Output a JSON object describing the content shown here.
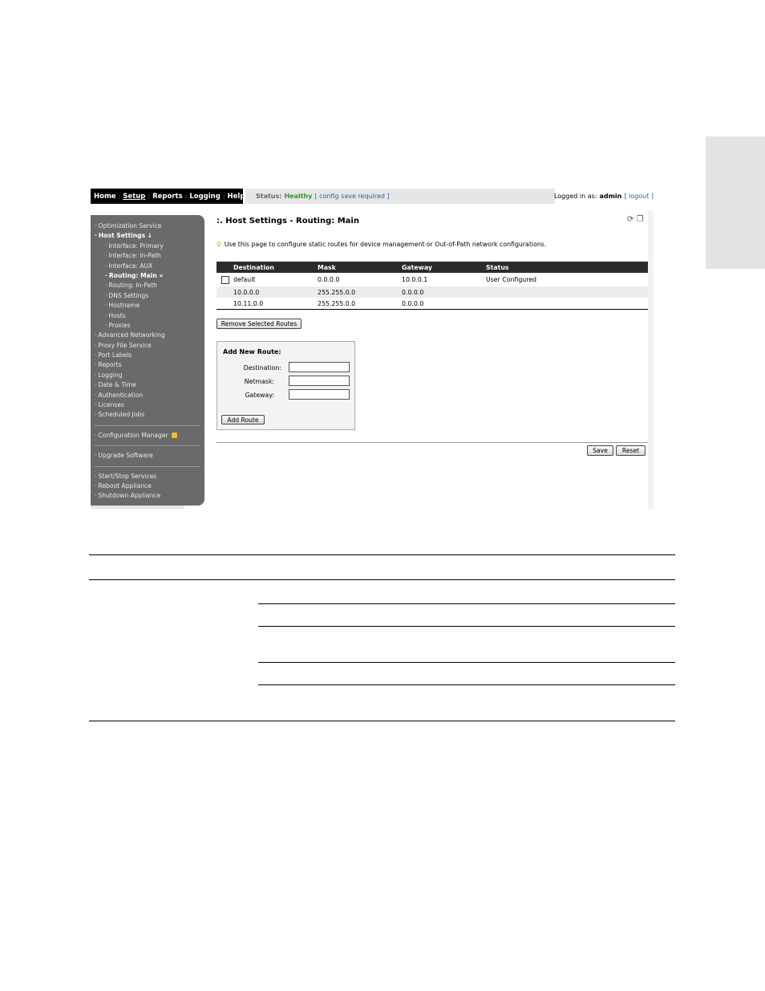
{
  "nav": {
    "items": [
      "Home",
      "Setup",
      "Reports",
      "Logging",
      "Help"
    ],
    "active_index": 1
  },
  "status": {
    "label": "Status:",
    "value": "Healthy",
    "link": "[ config save required ]"
  },
  "login": {
    "prefix": "Logged in as:",
    "user": "admin",
    "logout": "[ logout ]"
  },
  "sidebar": {
    "items": [
      {
        "label": "Optimization Service",
        "level": 0,
        "bold": false
      },
      {
        "label": "Host Settings ↓",
        "level": 0,
        "bold": true
      },
      {
        "label": "Interface: Primary",
        "level": 1,
        "bold": false
      },
      {
        "label": "Interface: In-Path",
        "level": 1,
        "bold": false
      },
      {
        "label": "Interface: AUX",
        "level": 1,
        "bold": false
      },
      {
        "label": "Routing: Main «",
        "level": 1,
        "bold": true
      },
      {
        "label": "Routing: In-Path",
        "level": 1,
        "bold": false
      },
      {
        "label": "DNS Settings",
        "level": 1,
        "bold": false
      },
      {
        "label": "Hostname",
        "level": 1,
        "bold": false
      },
      {
        "label": "Hosts",
        "level": 1,
        "bold": false
      },
      {
        "label": "Proxies",
        "level": 1,
        "bold": false
      },
      {
        "label": "Advanced Networking",
        "level": 0,
        "bold": false
      },
      {
        "label": "Proxy File Service",
        "level": 0,
        "bold": false
      },
      {
        "label": "Port Labels",
        "level": 0,
        "bold": false
      },
      {
        "label": "Reports",
        "level": 0,
        "bold": false
      },
      {
        "label": "Logging",
        "level": 0,
        "bold": false
      },
      {
        "label": "Date & Time",
        "level": 0,
        "bold": false
      },
      {
        "label": "Authentication",
        "level": 0,
        "bold": false
      },
      {
        "label": "Licenses",
        "level": 0,
        "bold": false
      },
      {
        "label": "Scheduled Jobs",
        "level": 0,
        "bold": false
      }
    ],
    "group2": [
      "Configuration Manager"
    ],
    "group3": [
      "Upgrade Software"
    ],
    "group4": [
      "Start/Stop Services",
      "Reboot Appliance",
      "Shutdown Appliance"
    ]
  },
  "page": {
    "title": ":. Host Settings - Routing: Main",
    "hint": "Use this page to configure static routes for device management or Out-of-Path network configurations.",
    "icons": [
      "refresh-icon",
      "help-book-icon"
    ]
  },
  "routes": {
    "headers": [
      "Destination",
      "Mask",
      "Gateway",
      "Status"
    ],
    "rows": [
      {
        "destination": "default",
        "mask": "0.0.0.0",
        "gateway": "10.0.0.1",
        "status": "User Configured",
        "checkbox": true
      },
      {
        "destination": "10.0.0.0",
        "mask": "255.255.0.0",
        "gateway": "0.0.0.0",
        "status": "",
        "checkbox": false
      },
      {
        "destination": "10.11.0.0",
        "mask": "255.255.0.0",
        "gateway": "0.0.0.0",
        "status": "",
        "checkbox": false
      }
    ],
    "remove_label": "Remove Selected Routes"
  },
  "add_route": {
    "title": "Add New Route:",
    "destination_label": "Destination:",
    "netmask_label": "Netmask:",
    "gateway_label": "Gateway:",
    "destination_value": "",
    "netmask_value": "",
    "gateway_value": "",
    "button": "Add Route"
  },
  "footer": {
    "save": "Save",
    "reset": "Reset"
  }
}
